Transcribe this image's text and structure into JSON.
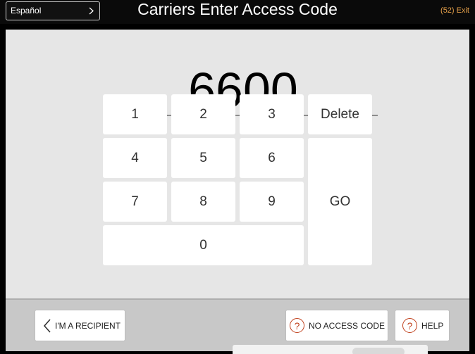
{
  "header": {
    "language_button": "Español",
    "title": "Carriers Enter Access Code",
    "exit_label": "(52) Exit"
  },
  "keypad": {
    "code_value": "6600",
    "keys": {
      "k1": "1",
      "k2": "2",
      "k3": "3",
      "k4": "4",
      "k5": "5",
      "k6": "6",
      "k7": "7",
      "k8": "8",
      "k9": "9",
      "k0": "0",
      "delete": "Delete",
      "go": "GO"
    }
  },
  "footer": {
    "recipient_button": "I'M A RECIPIENT",
    "no_code_button": "NO ACCESS CODE",
    "help_button": "HELP",
    "help_icon_glyph": "?"
  },
  "icons": [
    "chevron-right-icon",
    "chevron-left-icon",
    "question-circle-icon"
  ],
  "colors": {
    "exit_timer": "#e6a14a",
    "help_icon": "#c0401c",
    "panel_bg": "#e6e6e6"
  }
}
